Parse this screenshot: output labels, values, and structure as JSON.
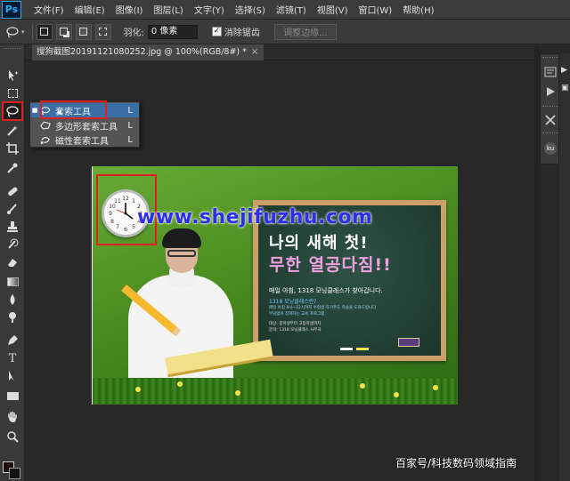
{
  "app": {
    "logo": "Ps",
    "menu": [
      "文件(F)",
      "编辑(E)",
      "图像(I)",
      "图层(L)",
      "文字(Y)",
      "选择(S)",
      "滤镜(T)",
      "视图(V)",
      "窗口(W)",
      "帮助(H)"
    ]
  },
  "options": {
    "feather_label": "羽化:",
    "feather_value": "0 像素",
    "antialias_label": "消除锯齿",
    "antialias_checked": true,
    "refine_edge_label": "调整边缘..."
  },
  "document": {
    "tab_title": "搜狗截图20191121080252.jpg @ 100%(RGB/8#) *",
    "tab_close": "×"
  },
  "flyout": {
    "items": [
      {
        "label": "套索工具",
        "shortcut": "L",
        "active": true
      },
      {
        "label": "多边形套索工具",
        "shortcut": "L",
        "active": false
      },
      {
        "label": "磁性套索工具",
        "shortcut": "L",
        "active": false
      }
    ]
  },
  "canvas": {
    "watermark": "www.shejifuzhu.com",
    "board_line1": "나의 새해 첫!",
    "board_line2": "무한 열공다짐!!",
    "board_line3": "매일 아침, 1318 모닝클래스가 찾아갑니다.",
    "board_line4": "1318 모닝클래스란?",
    "board_small1": "매일 아침 8시~12시까지 수험생 자기주도 학습을 도와드립니다",
    "board_small2": "부담없이 참여하는 교육 프로그램",
    "board_small3": "대상: 중학생부터 고등학생까지",
    "board_small4": "문의: 1318 모닝클래스 사무국"
  },
  "credit": "百家号/科技数码领域指南",
  "colors": {
    "highlight": "#e02020",
    "flyout_active": "#3a6ea5",
    "watermark": "#2e2ef0"
  }
}
